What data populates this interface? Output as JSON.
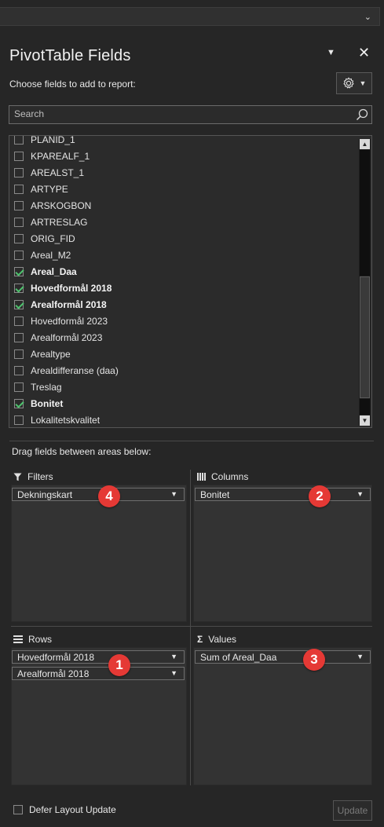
{
  "panel": {
    "title": "PivotTable Fields",
    "choose_label": "Choose fields to add to report:",
    "search_placeholder": "Search",
    "drag_label": "Drag fields between areas below:"
  },
  "fields": [
    {
      "label": "PLANID_1",
      "checked": false
    },
    {
      "label": "KPAREALF_1",
      "checked": false
    },
    {
      "label": "AREALST_1",
      "checked": false
    },
    {
      "label": "ARTYPE",
      "checked": false
    },
    {
      "label": "ARSKOGBON",
      "checked": false
    },
    {
      "label": "ARTRESLAG",
      "checked": false
    },
    {
      "label": "ORIG_FID",
      "checked": false
    },
    {
      "label": "Areal_M2",
      "checked": false
    },
    {
      "label": "Areal_Daa",
      "checked": true
    },
    {
      "label": "Hovedformål 2018",
      "checked": true
    },
    {
      "label": "Arealformål 2018",
      "checked": true
    },
    {
      "label": "Hovedformål 2023",
      "checked": false
    },
    {
      "label": "Arealformål 2023",
      "checked": false
    },
    {
      "label": "Arealtype",
      "checked": false
    },
    {
      "label": "Arealdifferanse (daa)",
      "checked": false
    },
    {
      "label": "Treslag",
      "checked": false
    },
    {
      "label": "Bonitet",
      "checked": true
    },
    {
      "label": "Lokalitetskvalitet",
      "checked": false
    }
  ],
  "areas": {
    "filters": {
      "label": "Filters",
      "items": [
        "Dekningskart"
      ],
      "badge": "4"
    },
    "columns": {
      "label": "Columns",
      "items": [
        "Bonitet"
      ],
      "badge": "2"
    },
    "rows": {
      "label": "Rows",
      "items": [
        "Hovedformål 2018",
        "Arealformål 2018"
      ],
      "badge": "1"
    },
    "values": {
      "label": "Values",
      "items": [
        "Sum of Areal_Daa"
      ],
      "badge": "3",
      "icon_glyph": "Σ"
    }
  },
  "footer": {
    "defer_label": "Defer Layout Update",
    "update_label": "Update"
  },
  "icons": {
    "title_dropdown": "chevron-down-icon",
    "close": "close-icon",
    "settings": "gear-icon",
    "search": "search-icon"
  },
  "colors": {
    "background": "#262626",
    "check": "#4fc36e",
    "badge": "#e53935"
  }
}
